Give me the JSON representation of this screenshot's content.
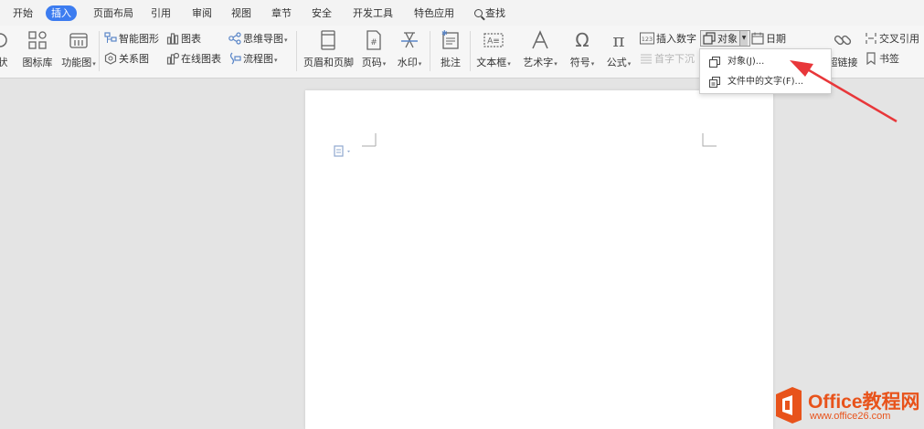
{
  "menu": {
    "tabs": [
      {
        "label": "开始"
      },
      {
        "label": "插入"
      },
      {
        "label": "页面布局"
      },
      {
        "label": "引用"
      },
      {
        "label": "审阅"
      },
      {
        "label": "视图"
      },
      {
        "label": "章节"
      },
      {
        "label": "安全"
      },
      {
        "label": "开发工具"
      },
      {
        "label": "特色应用"
      }
    ],
    "active_tab": "插入",
    "search_label": "查找"
  },
  "ribbon": {
    "shape_partial": "状",
    "icon_library": "图标库",
    "function_chart": "功能图",
    "smart_graphic": "智能图形",
    "chart": "图表",
    "mind_map": "思维导图",
    "relation_chart": "关系图",
    "online_chart": "在线图表",
    "flowchart": "流程图",
    "header_footer": "页眉和页脚",
    "page_number": "页码",
    "watermark": "水印",
    "comment": "批注",
    "text_box": "文本框",
    "art_text": "艺术字",
    "symbol": "符号",
    "formula": "公式",
    "insert_number": "插入数字",
    "object": "对象",
    "date": "日期",
    "drop_cap": "首字下沉",
    "hyperlink": "超链接",
    "cross_reference": "交叉引用",
    "bookmark": "书签",
    "number_icon_text": "123"
  },
  "dropdown": {
    "items": [
      {
        "label": "对象(J)..."
      },
      {
        "label": "文件中的文字(F)..."
      }
    ]
  },
  "colors": {
    "accent": "#3c7cf0",
    "arrow": "#e8373a",
    "watermark": "#e8531b"
  },
  "watermark": {
    "title": "Office教程网",
    "url": "www.office26.com"
  }
}
